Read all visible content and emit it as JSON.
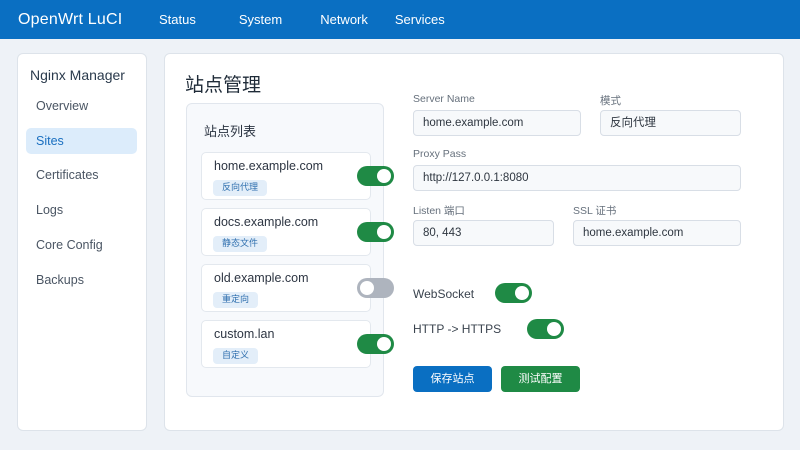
{
  "app": {
    "brand": "OpenWrt LuCI"
  },
  "topnav": [
    "Status",
    "System",
    "Network",
    "Services"
  ],
  "sidebar": {
    "title": "Nginx Manager",
    "items": [
      {
        "label": "Overview"
      },
      {
        "label": "Sites",
        "active": true
      },
      {
        "label": "Certificates"
      },
      {
        "label": "Logs"
      },
      {
        "label": "Core Config"
      },
      {
        "label": "Backups"
      }
    ]
  },
  "main": {
    "title": "站点管理",
    "site_list": {
      "title": "站点列表",
      "sites": [
        {
          "domain": "home.example.com",
          "tag": "反向代理",
          "enabled": true
        },
        {
          "domain": "docs.example.com",
          "tag": "静态文件",
          "enabled": true
        },
        {
          "domain": "old.example.com",
          "tag": "重定向",
          "enabled": false
        },
        {
          "domain": "custom.lan",
          "tag": "自定义",
          "enabled": true
        }
      ]
    },
    "form": {
      "server_name_label": "Server Name",
      "server_name_value": "home.example.com",
      "mode_label": "模式",
      "mode_value": "反向代理",
      "proxy_pass_label": "Proxy Pass",
      "proxy_pass_value": "http://127.0.0.1:8080",
      "listen_label": "Listen 端口",
      "listen_value": "80, 443",
      "ssl_label": "SSL 证书",
      "ssl_value": "home.example.com",
      "websocket_label": "WebSocket",
      "websocket_on": true,
      "https_redirect_label": "HTTP -> HTTPS",
      "https_redirect_on": true
    },
    "buttons": {
      "save": "保存站点",
      "test": "测试配置"
    }
  },
  "colors": {
    "header": "#0a6fc2",
    "accent": "#1a6fc0",
    "toggle_on": "#1f8a45",
    "toggle_off": "#aeb4be",
    "success_button": "#1f8a45"
  }
}
